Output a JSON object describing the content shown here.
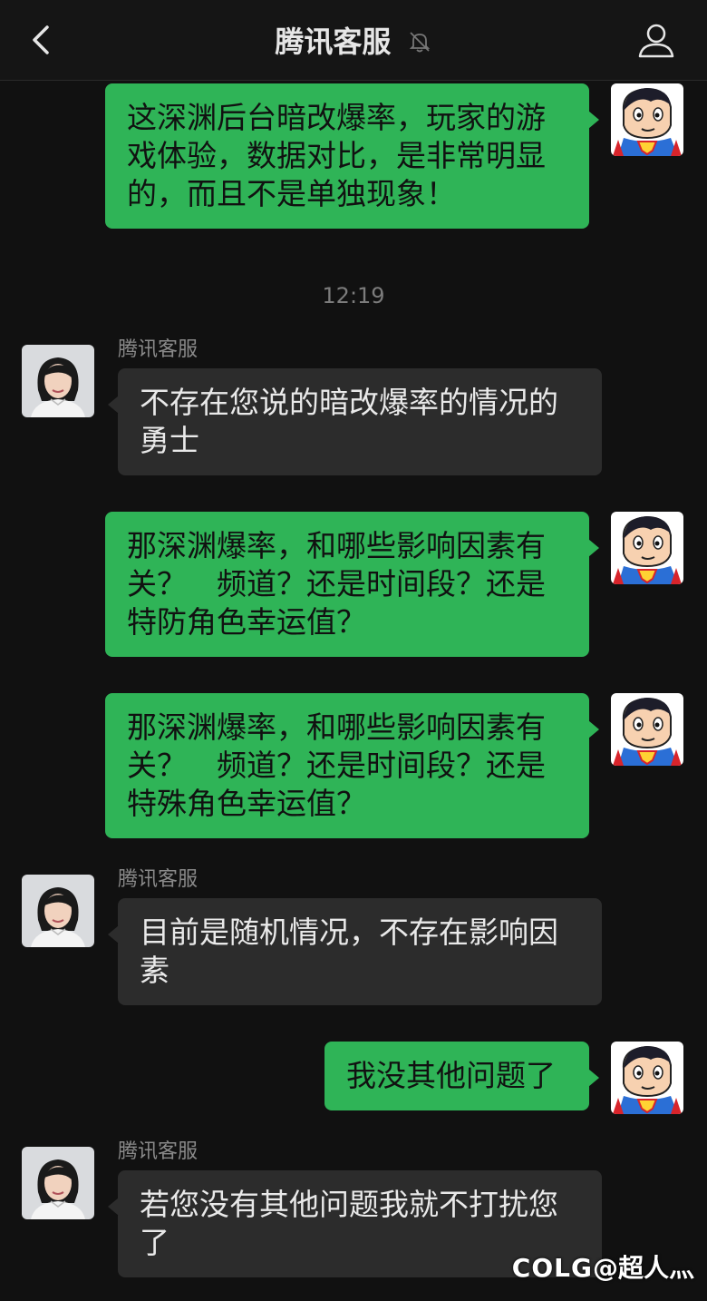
{
  "header": {
    "title": "腾讯客服"
  },
  "timestamp": "12:19",
  "messages": [
    {
      "side": "out",
      "text": "这深渊后台暗改爆率，玩家的游戏体验，数据对比，是非常明显的，而且不是单独现象！"
    },
    {
      "side": "in",
      "sender": "腾讯客服",
      "text": "不存在您说的暗改爆率的情况的勇士"
    },
    {
      "side": "out",
      "text": "那深渊爆率，和哪些影响因素有关？　频道？还是时间段？还是特防角色幸运值？"
    },
    {
      "side": "out",
      "text": "那深渊爆率，和哪些影响因素有关？　频道？还是时间段？还是特殊角色幸运值？"
    },
    {
      "side": "in",
      "sender": "腾讯客服",
      "text": "目前是随机情况，不存在影响因素"
    },
    {
      "side": "out",
      "text": "我没其他问题了"
    },
    {
      "side": "in",
      "sender": "腾讯客服",
      "text": "若您没有其他问题我就不打扰您了"
    }
  ],
  "watermark": {
    "logo": "COLG",
    "user": "@超人灬"
  },
  "colors": {
    "background": "#111111",
    "outgoing_bubble": "#2fb457",
    "incoming_bubble": "#2c2c2c"
  },
  "icons": [
    "back-arrow-icon",
    "mute-bell-icon",
    "profile-icon",
    "superman-avatar",
    "agent-avatar"
  ]
}
